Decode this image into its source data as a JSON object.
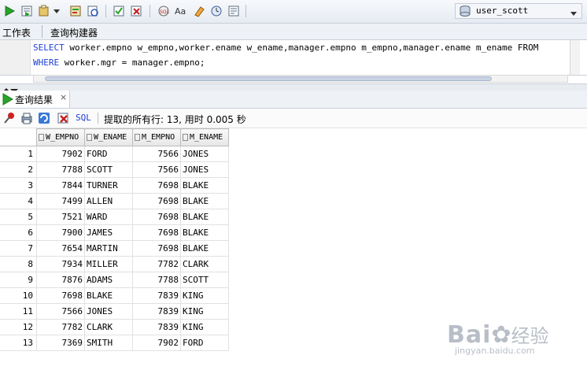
{
  "toolbar": {
    "connection": "user_scott",
    "icons": [
      "run-statement-icon",
      "run-script-icon",
      "explain-plan-icon",
      "autotrace-icon",
      "sql-tuning-icon",
      "commit-icon",
      "rollback-icon",
      "sql-history-icon",
      "uppercase-icon",
      "clear-icon",
      "unshared-worksheet-icon",
      "db-connection-icon"
    ]
  },
  "worksheet_tabs": [
    "工作表",
    "查询构建器"
  ],
  "editor": {
    "line1_kw": "SELECT",
    "line1_rest": " worker.empno w_empno,worker.ename w_ename,manager.empno m_empno,manager.ename m_ename FROM",
    "line2_kw": "WHERE",
    "line2_rest": " worker.mgr = manager.empno;"
  },
  "results": {
    "tab_label": "查询结果",
    "sql_label": "SQL",
    "status": "提取的所有行: 13, 用时 0.005 秒",
    "columns": [
      "W_EMPNO",
      "W_ENAME",
      "M_EMPNO",
      "M_ENAME"
    ],
    "rows": [
      [
        "1",
        "7902",
        "FORD",
        "7566",
        "JONES"
      ],
      [
        "2",
        "7788",
        "SCOTT",
        "7566",
        "JONES"
      ],
      [
        "3",
        "7844",
        "TURNER",
        "7698",
        "BLAKE"
      ],
      [
        "4",
        "7499",
        "ALLEN",
        "7698",
        "BLAKE"
      ],
      [
        "5",
        "7521",
        "WARD",
        "7698",
        "BLAKE"
      ],
      [
        "6",
        "7900",
        "JAMES",
        "7698",
        "BLAKE"
      ],
      [
        "7",
        "7654",
        "MARTIN",
        "7698",
        "BLAKE"
      ],
      [
        "8",
        "7934",
        "MILLER",
        "7782",
        "CLARK"
      ],
      [
        "9",
        "7876",
        "ADAMS",
        "7788",
        "SCOTT"
      ],
      [
        "10",
        "7698",
        "BLAKE",
        "7839",
        "KING"
      ],
      [
        "11",
        "7566",
        "JONES",
        "7839",
        "KING"
      ],
      [
        "12",
        "7782",
        "CLARK",
        "7839",
        "KING"
      ],
      [
        "13",
        "7369",
        "SMITH",
        "7902",
        "FORD"
      ]
    ]
  },
  "watermark": {
    "brand": "Bai",
    "brand2": "经验",
    "url": "jingyan.baidu.com"
  },
  "colors": {
    "accent": "#1f3fd6",
    "run_green": "#2aa32a"
  }
}
